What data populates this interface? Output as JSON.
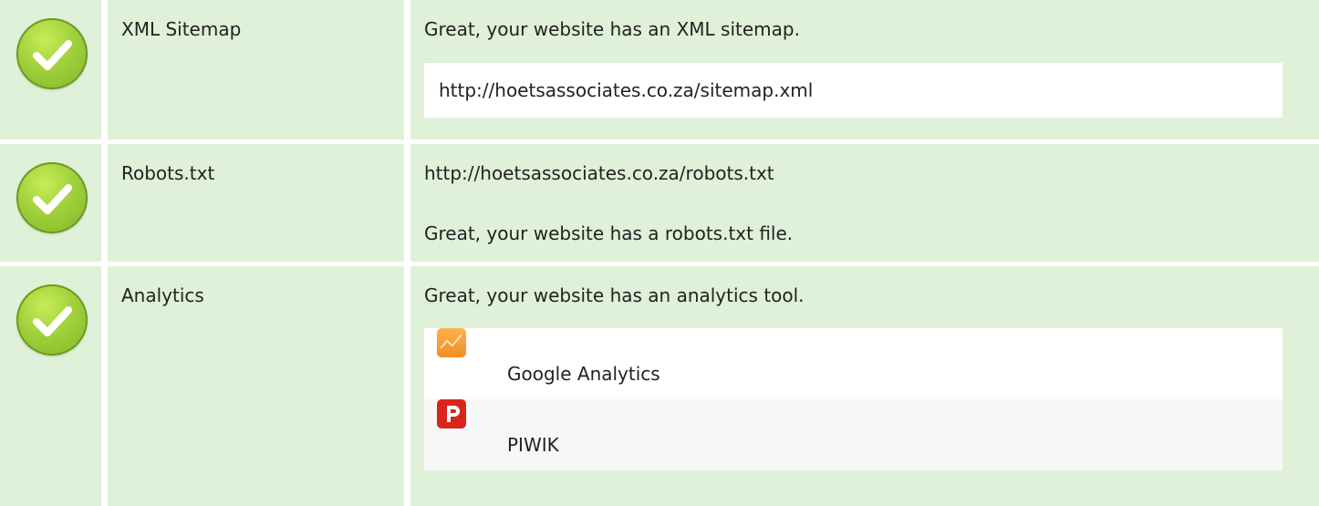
{
  "rows": [
    {
      "label": "XML Sitemap",
      "status_icon": "check-icon",
      "message": "Great, your website has an XML sitemap.",
      "url": "http://hoetsassociates.co.za/sitemap.xml"
    },
    {
      "label": "Robots.txt",
      "status_icon": "check-icon",
      "message_1": "http://hoetsassociates.co.za/robots.txt",
      "message_2": "Great, your website has a robots.txt file."
    },
    {
      "label": "Analytics",
      "status_icon": "check-icon",
      "message": "Great, your website has an analytics tool.",
      "tools": [
        {
          "name": "Google Analytics",
          "icon": "google-analytics-icon",
          "color": "#f7a13b"
        },
        {
          "name": "PIWIK",
          "icon": "piwik-icon",
          "color": "#d9251c"
        }
      ]
    }
  ],
  "colors": {
    "row_background": "#dff1d8",
    "check_green": "#9fd13a"
  }
}
